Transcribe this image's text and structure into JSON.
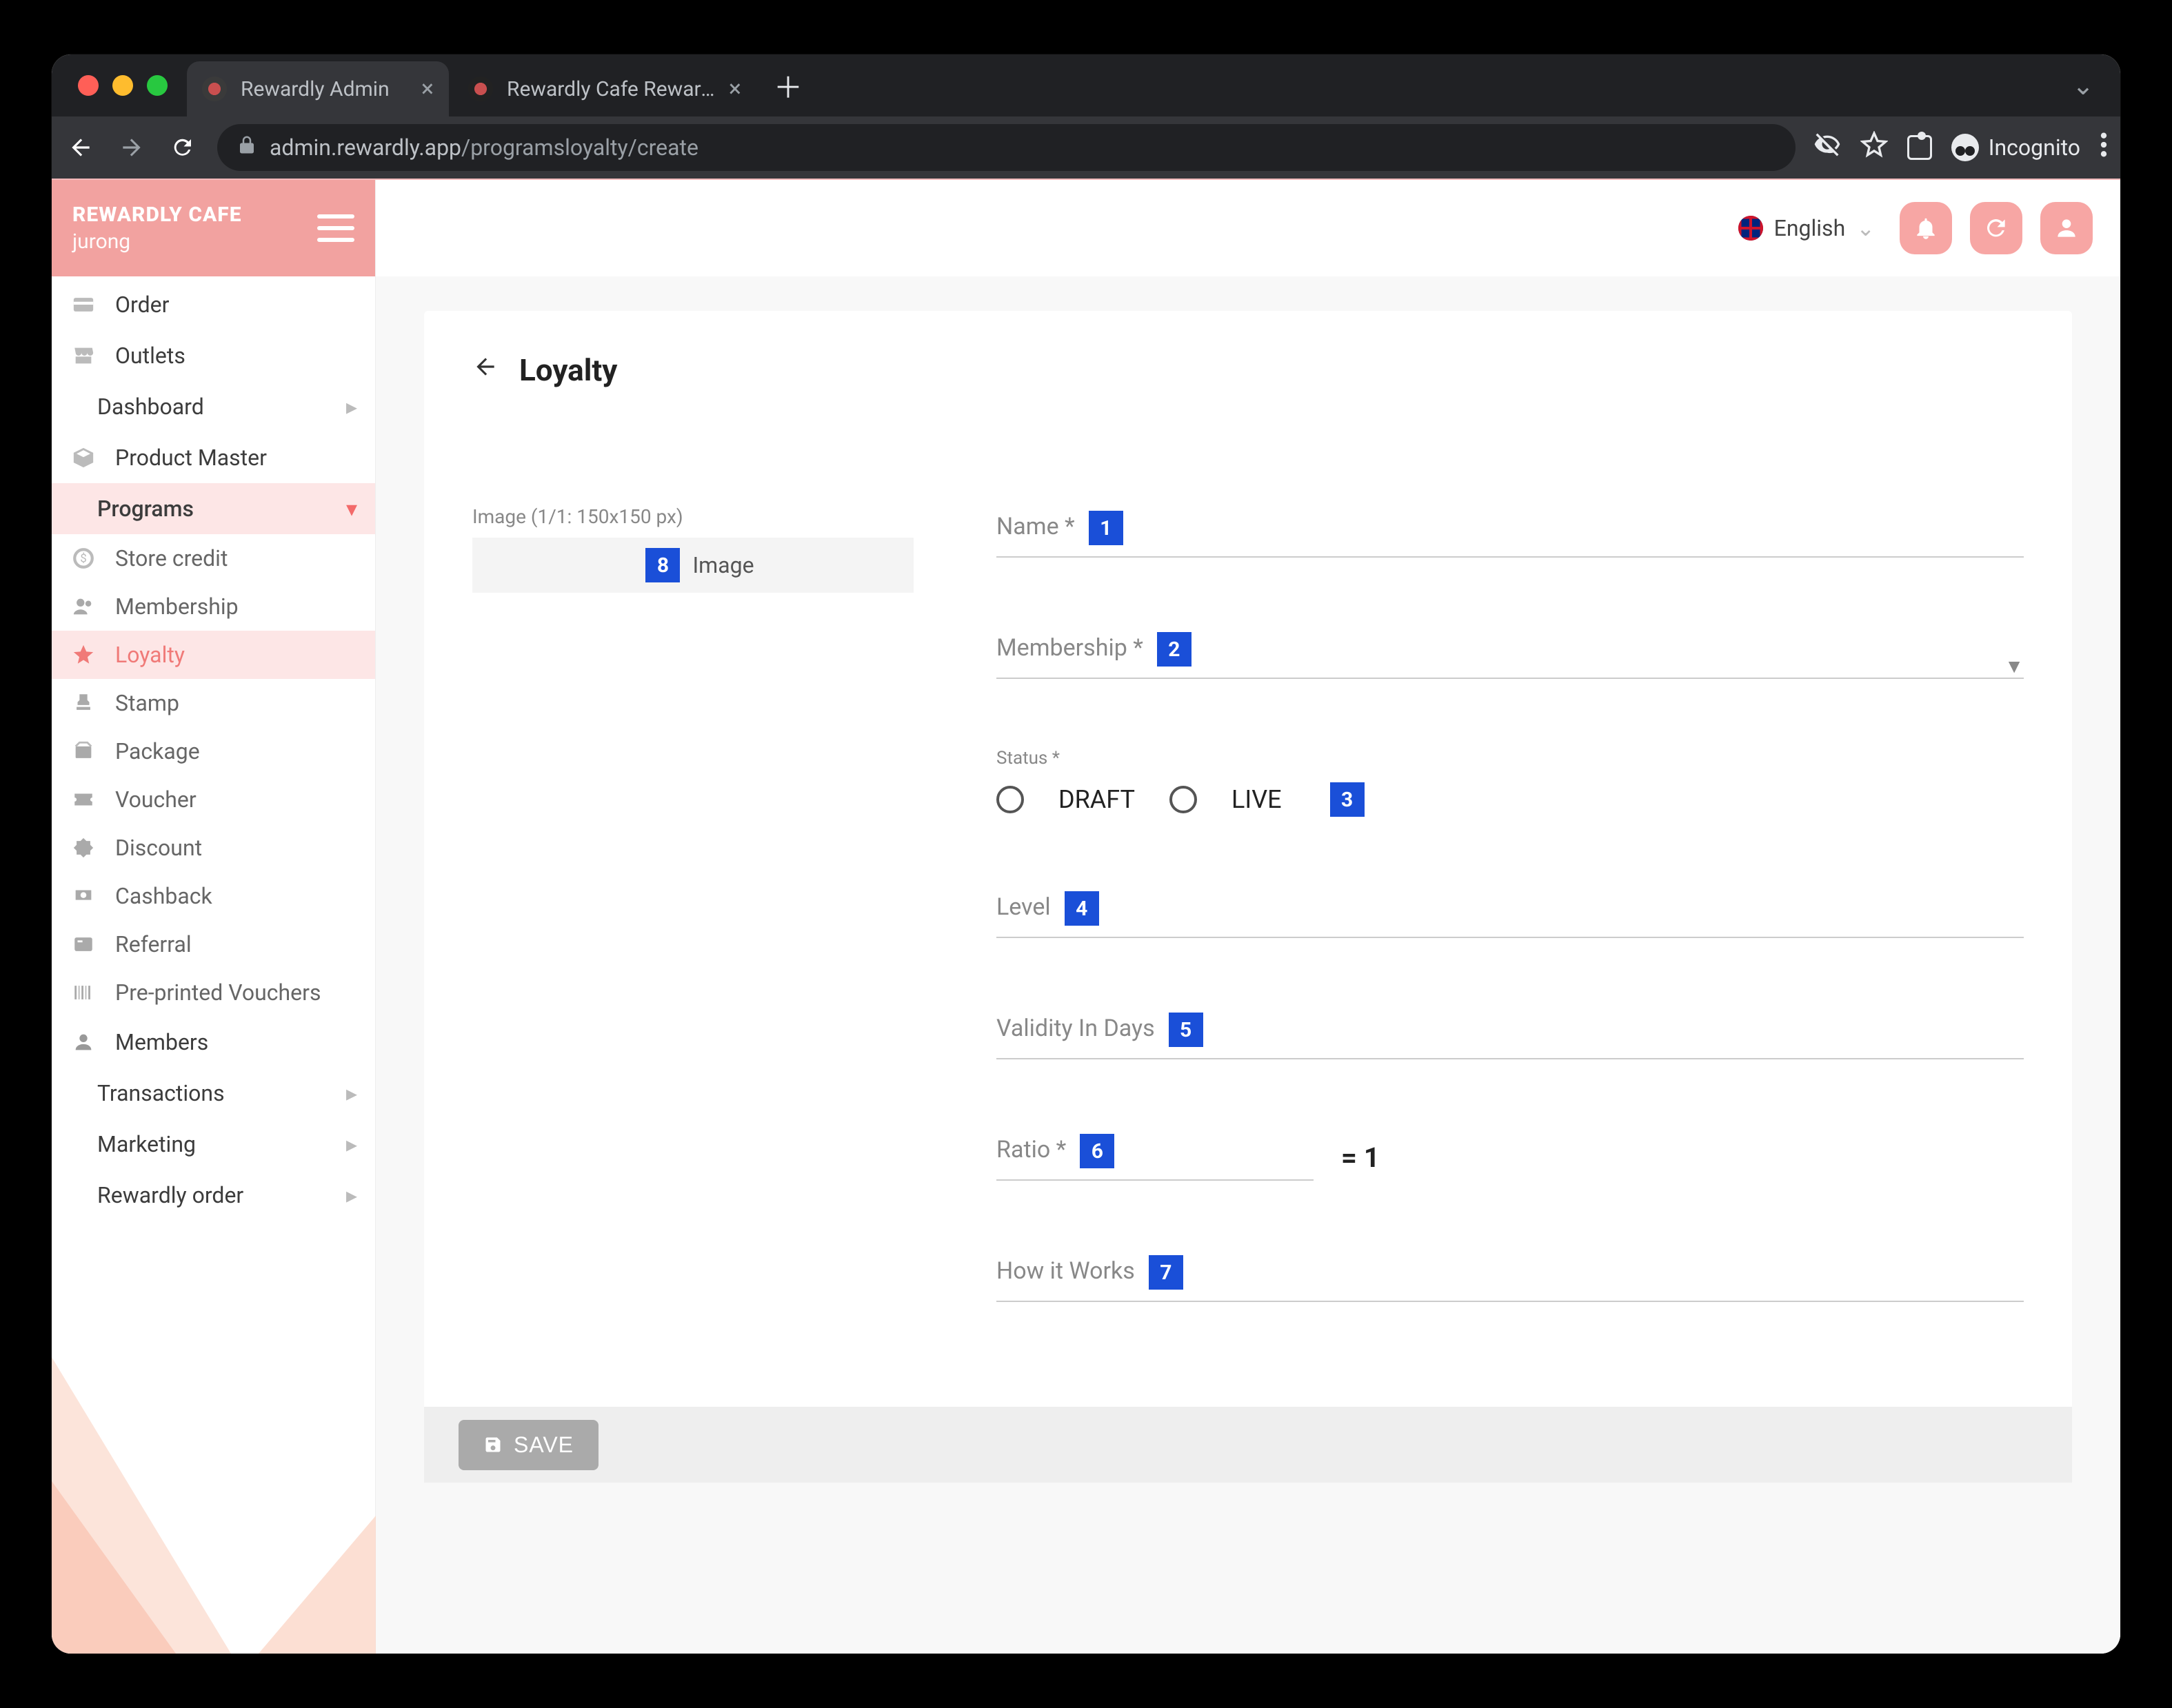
{
  "browser": {
    "tabs": [
      {
        "title": "Rewardly Admin",
        "active": true
      },
      {
        "title": "Rewardly Cafe Rewardly Loyalt",
        "active": false
      }
    ],
    "url_host": "admin.rewardly.app",
    "url_path": "/programsloyalty/create",
    "mode": "Incognito"
  },
  "brand": {
    "name": "REWARDLY CAFE",
    "location": "jurong"
  },
  "sidebar": {
    "items": [
      {
        "icon": "card",
        "label": "Order"
      },
      {
        "icon": "store",
        "label": "Outlets"
      },
      {
        "icon": "",
        "label": "Dashboard",
        "chev": true,
        "sub": true
      },
      {
        "icon": "box",
        "label": "Product Master"
      },
      {
        "icon": "",
        "label": "Programs",
        "chev": true,
        "sub": true,
        "expanded": true
      }
    ],
    "programs": [
      {
        "icon": "coin",
        "label": "Store credit"
      },
      {
        "icon": "members",
        "label": "Membership"
      },
      {
        "icon": "star",
        "label": "Loyalty",
        "active": true
      },
      {
        "icon": "stamp",
        "label": "Stamp"
      },
      {
        "icon": "package",
        "label": "Package"
      },
      {
        "icon": "voucher",
        "label": "Voucher"
      },
      {
        "icon": "discount",
        "label": "Discount"
      },
      {
        "icon": "cashback",
        "label": "Cashback"
      },
      {
        "icon": "referral",
        "label": "Referral"
      },
      {
        "icon": "barcode",
        "label": "Pre-printed Vouchers"
      }
    ],
    "after": [
      {
        "icon": "user",
        "label": "Members"
      },
      {
        "icon": "",
        "label": "Transactions",
        "chev": true,
        "sub": true
      },
      {
        "icon": "",
        "label": "Marketing",
        "chev": true,
        "sub": true
      },
      {
        "icon": "",
        "label": "Rewardly order",
        "chev": true,
        "sub": true
      }
    ]
  },
  "topbar": {
    "language": "English"
  },
  "page": {
    "title": "Loyalty",
    "image_label": "Image (1/1: 150x150 px)",
    "image_drop": "Image",
    "marker_image": "8",
    "fields": {
      "name": {
        "label": "Name *",
        "marker": "1"
      },
      "membership": {
        "label": "Membership *",
        "marker": "2"
      },
      "status": {
        "label": "Status *",
        "opt1": "DRAFT",
        "opt2": "LIVE",
        "marker": "3"
      },
      "level": {
        "label": "Level",
        "marker": "4"
      },
      "validity": {
        "label": "Validity In Days",
        "marker": "5"
      },
      "ratio": {
        "label": "Ratio *",
        "marker": "6",
        "suffix": "= 1"
      },
      "how": {
        "label": "How it Works",
        "marker": "7"
      }
    },
    "save": "SAVE"
  }
}
